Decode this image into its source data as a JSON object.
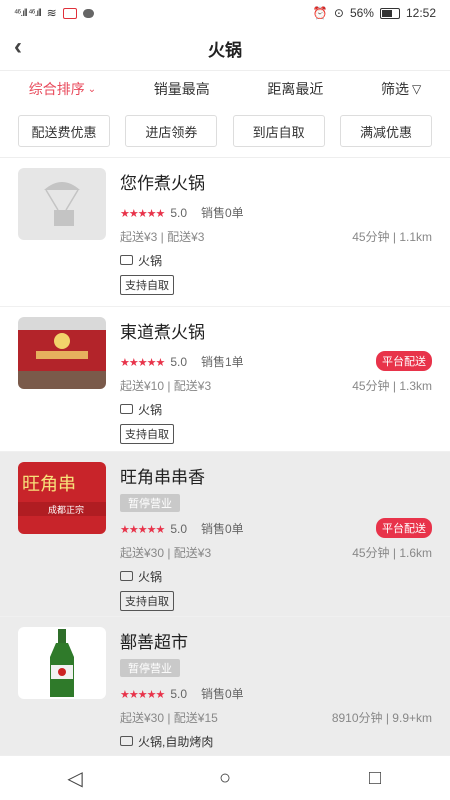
{
  "status": {
    "left": "⁴⁶.ıll ⁴⁶.ıll",
    "battery": "56%",
    "time": "12:52"
  },
  "header": {
    "title": "火锅"
  },
  "sort": [
    {
      "label": "综合排序"
    },
    {
      "label": "销量最高"
    },
    {
      "label": "距离最近"
    },
    {
      "label": "筛选"
    }
  ],
  "chips": [
    "配送费优惠",
    "进店领券",
    "到店自取",
    "满减优惠"
  ],
  "stores": [
    {
      "name": "您作煮火锅",
      "score": "5.0",
      "sales": "销售0单",
      "fee": "起送¥3 | 配送¥3",
      "eta": "45分钟 | 1.1km",
      "tag": "火锅",
      "pickup": "支持自取",
      "badge": "",
      "status": ""
    },
    {
      "name": "東道煮火锅",
      "score": "5.0",
      "sales": "销售1单",
      "fee": "起送¥10 | 配送¥3",
      "eta": "45分钟 | 1.3km",
      "tag": "火锅",
      "pickup": "支持自取",
      "badge": "平台配送",
      "status": ""
    },
    {
      "name": "旺角串串香",
      "score": "5.0",
      "sales": "销售0单",
      "fee": "起送¥30 | 配送¥3",
      "eta": "45分钟 | 1.6km",
      "tag": "火锅",
      "pickup": "支持自取",
      "badge": "平台配送",
      "status": "暂停营业"
    },
    {
      "name": "鄯善超市",
      "score": "5.0",
      "sales": "销售0单",
      "fee": "起送¥30 | 配送¥15",
      "eta": "8910分钟 | 9.9+km",
      "tag": "火锅,自助烤肉",
      "pickup": "",
      "badge": "",
      "status": "暂停营业"
    }
  ],
  "colors": {
    "accent": "#e84a5b",
    "star": "#e8334a",
    "closed_bg": "#ececec"
  }
}
